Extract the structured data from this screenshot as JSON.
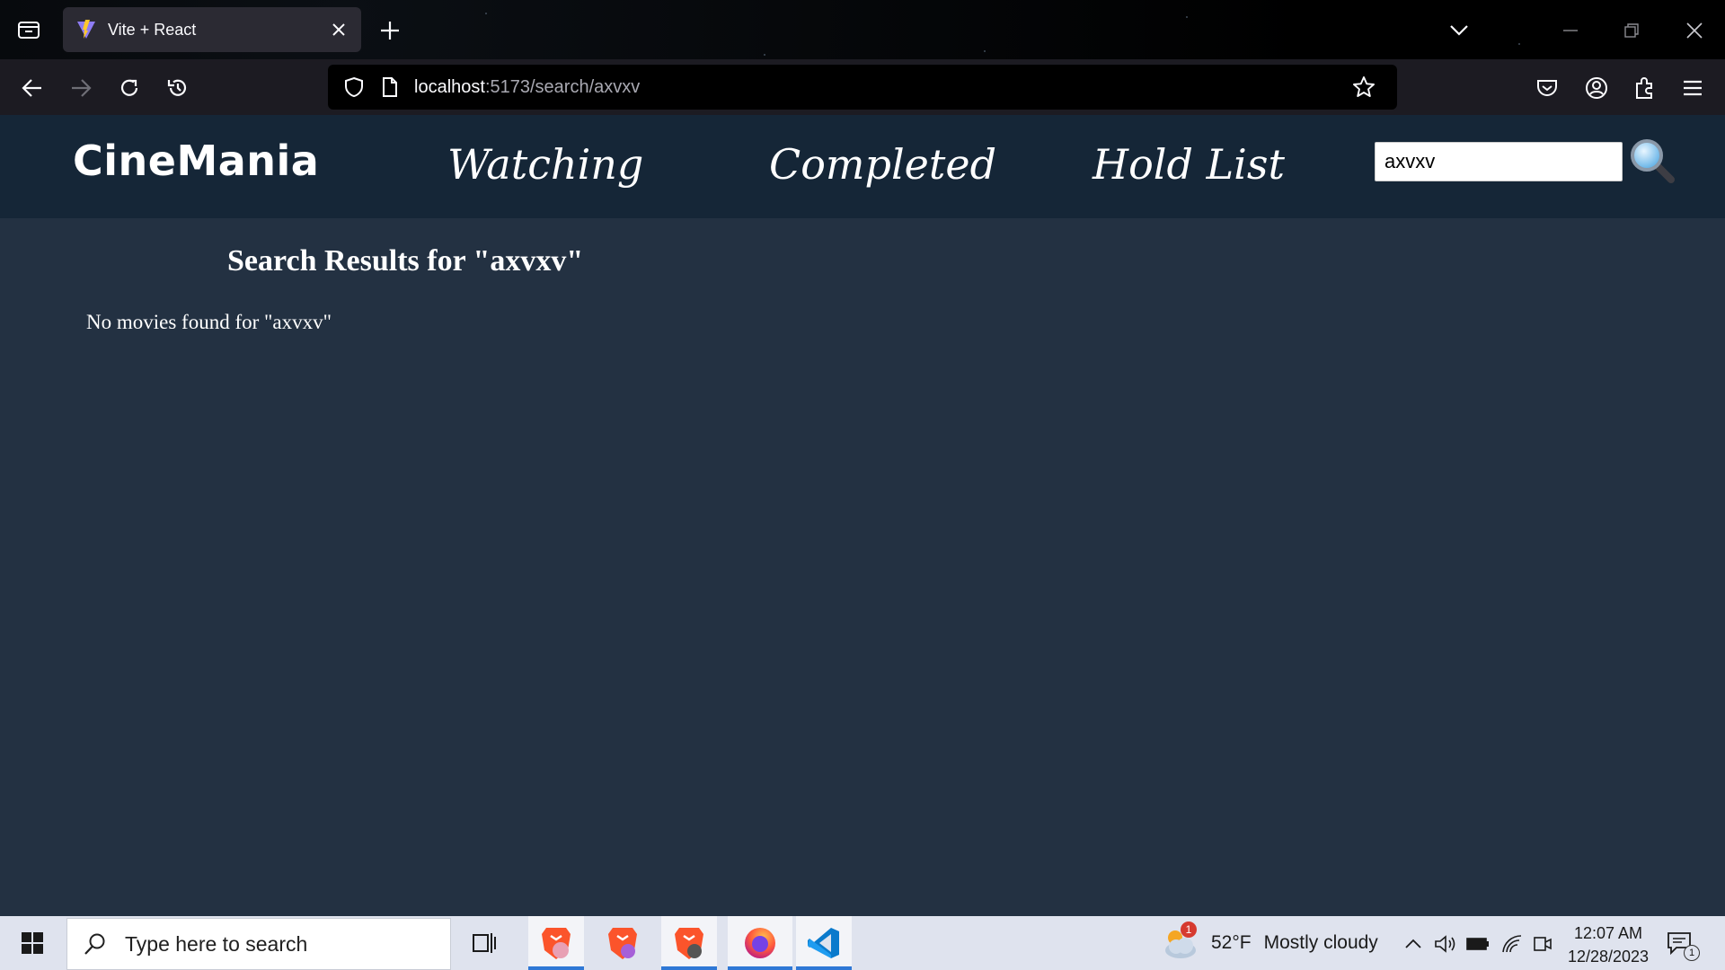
{
  "browser": {
    "tab_title": "Vite + React",
    "url_host": "localhost",
    "url_path": ":5173/search/axvxv"
  },
  "app": {
    "logo": "CineMania",
    "nav": [
      "Watching",
      "Completed",
      "Hold List"
    ],
    "search_value": "axvxv",
    "results_title": "Search Results for \"axvxv\"",
    "no_results": "No movies found for \"axvxv\""
  },
  "taskbar": {
    "search_placeholder": "Type here to search",
    "weather_badge": "1",
    "weather_temp": "52°F",
    "weather_desc": "Mostly cloudy",
    "time": "12:07 AM",
    "date": "12/28/2023",
    "notification_count": "1"
  },
  "colors": {
    "page_bg": "#233142",
    "header_bg": "#152637",
    "accent_taskbar": "#2f78d6"
  },
  "icons": [
    "tab-list-icon",
    "vite-favicon-icon",
    "close-icon",
    "plus-icon",
    "chevron-down-icon",
    "minimize-icon",
    "restore-icon",
    "back-icon",
    "forward-icon",
    "reload-icon",
    "history-icon",
    "shield-icon",
    "page-icon",
    "star-icon",
    "pocket-icon",
    "account-icon",
    "extensions-icon",
    "menu-icon",
    "magnifier-icon",
    "windows-start-icon",
    "task-view-icon",
    "brave-icon",
    "firefox-icon",
    "vscode-icon",
    "weather-cloud-icon",
    "chevron-up-icon",
    "volume-icon",
    "battery-icon",
    "wifi-icon",
    "meet-icon",
    "notification-icon"
  ]
}
